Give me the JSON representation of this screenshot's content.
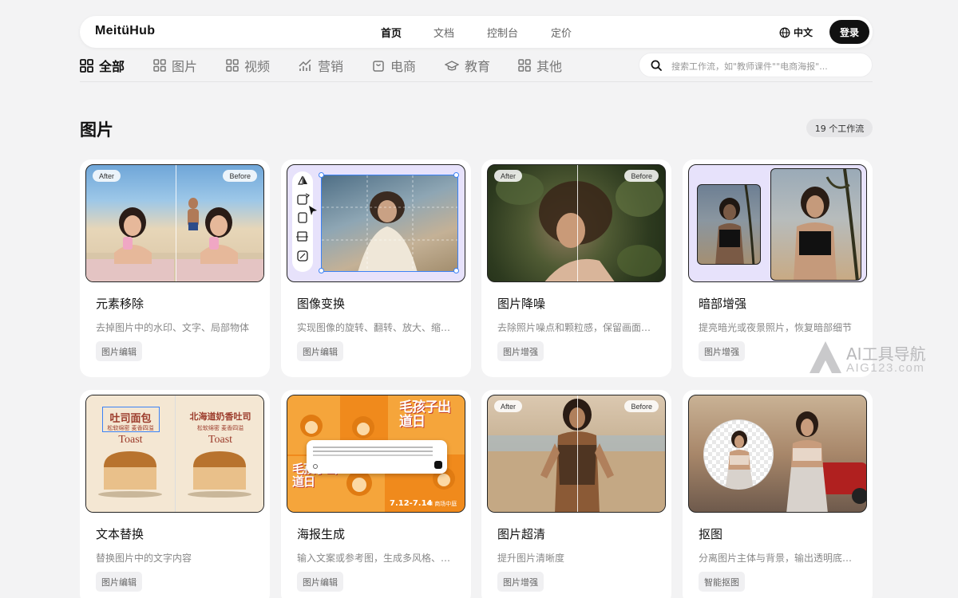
{
  "header": {
    "logo": "MeitüHub",
    "nav": [
      "首页",
      "文档",
      "控制台",
      "定价"
    ],
    "language": "中文",
    "login": "登录"
  },
  "categories": [
    "全部",
    "图片",
    "视频",
    "营销",
    "电商",
    "教育",
    "其他"
  ],
  "search": {
    "placeholder": "搜索工作流，如\"教师课件\"\"电商海报\"..."
  },
  "section": {
    "title": "图片",
    "count": "19 个工作流"
  },
  "cards": [
    {
      "title": "元素移除",
      "desc": "去掉图片中的水印、文字、局部物体",
      "tag": "图片编辑",
      "after": "After",
      "before": "Before"
    },
    {
      "title": "图像变换",
      "desc": "实现图像的旋转、翻转、放大、缩小...",
      "tag": "图片编辑"
    },
    {
      "title": "图片降噪",
      "desc": "去除照片噪点和颗粒感，保留画面细节",
      "tag": "图片增强",
      "after": "After",
      "before": "Before"
    },
    {
      "title": "暗部增强",
      "desc": "提亮暗光或夜景照片，恢复暗部细节",
      "tag": "图片增强"
    },
    {
      "title": "文本替换",
      "desc": "替换图片中的文字内容",
      "tag": "图片编辑",
      "poster_left": "吐司面包",
      "poster_left_sub": "松软绵密 麦香四溢",
      "poster_right": "北海道奶香吐司",
      "poster_right_sub": "松软绵密 麦香四溢",
      "toast": "Toast"
    },
    {
      "title": "海报生成",
      "desc": "输入文案或参考图，生成多风格、多...",
      "tag": "图片编辑",
      "poster_text": "毛孩子出道日",
      "date_text": "7.12-7.14",
      "venue": "M 商场中庭"
    },
    {
      "title": "图片超清",
      "desc": "提升图片清晰度",
      "tag": "图片增强",
      "after": "After",
      "before": "Before"
    },
    {
      "title": "抠图",
      "desc": "分离图片主体与背景，输出透明底或...",
      "tag": "智能抠图"
    }
  ],
  "watermark": {
    "line1": "AI工具导航",
    "line2": "AIG123.com"
  },
  "colors": {
    "accent": "#111111",
    "background": "#f3f3f4",
    "selection": "#3b82f6",
    "lavender": "#e7e2fb",
    "poster_orange": "#f08a1c"
  }
}
